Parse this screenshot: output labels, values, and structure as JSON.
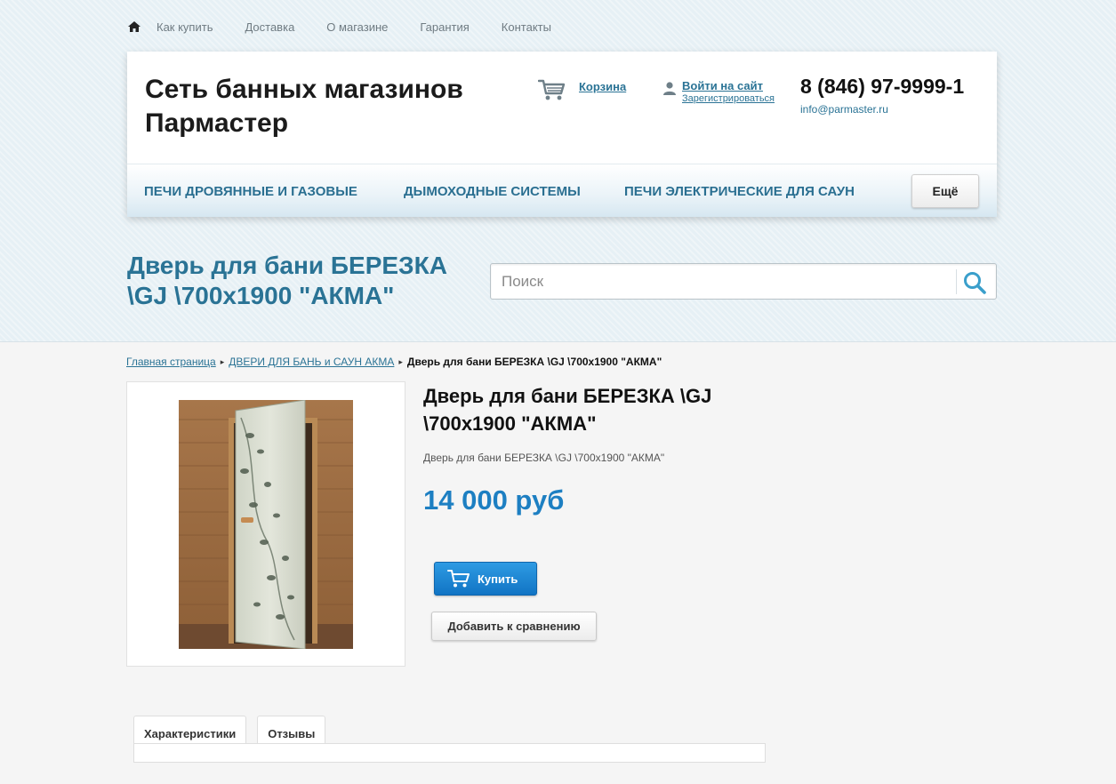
{
  "topnav": {
    "home_icon": "home-icon",
    "links": [
      "Как купить",
      "Доставка",
      "О магазине",
      "Гарантия",
      "Контакты"
    ]
  },
  "header": {
    "site_title": "Сеть банных магазинов Пармастер",
    "cart": {
      "icon": "cart-icon",
      "label": "Корзина"
    },
    "login": {
      "icon": "user-icon",
      "label": "Войти на сайт",
      "register": "Зарегистрироваться"
    },
    "phone": "8 (846) 97-9999-1",
    "email": "info@parmaster.ru"
  },
  "menu": {
    "items": [
      "ПЕЧИ ДРОВЯННЫЕ И ГАЗОВЫЕ",
      "ДЫМОХОДНЫЕ СИСТЕМЫ",
      "ПЕЧИ ЭЛЕКТРИЧЕСКИЕ ДЛЯ САУН"
    ],
    "more": "Ещё"
  },
  "page_title": "Дверь для бани БЕРЕЗКА \\GJ \\700x1900 \"АКМА\"",
  "search": {
    "placeholder": "Поиск",
    "icon": "search-icon"
  },
  "breadcrumb": {
    "items": [
      "Главная страница",
      "ДВЕРИ ДЛЯ БАНЬ и САУН АКМА"
    ],
    "current": "Дверь для бани БЕРЕЗКА \\GJ \\700x1900 \"АКМА\""
  },
  "product": {
    "name": "Дверь для бани БЕРЕЗКА \\GJ \\700x1900 \"АКМА\"",
    "description": "Дверь для бани БЕРЕЗКА \\GJ \\700x1900 \"АКМА\"",
    "price": "14 000 руб",
    "buy_label": "Купить",
    "compare_label": "Добавить к сравнению"
  },
  "tabs": [
    "Характеристики",
    "Отзывы"
  ],
  "colors": {
    "accent": "#2a7395",
    "price": "#1d7fc2",
    "buy_button": "#1a86d3"
  }
}
